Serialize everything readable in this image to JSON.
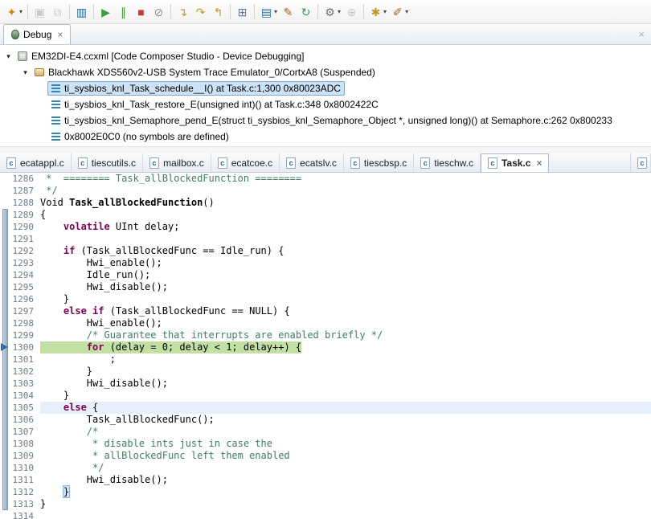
{
  "toolbar": {
    "items": [
      {
        "name": "new",
        "glyph": "✦",
        "color": "#c08a00",
        "dropdown": true
      },
      {
        "sep": true
      },
      {
        "name": "save",
        "glyph": "▣",
        "color": "#8a8a8a",
        "disabled": true
      },
      {
        "name": "save-all",
        "glyph": "⧉",
        "color": "#8a8a8a",
        "disabled": true
      },
      {
        "sep": true
      },
      {
        "name": "console",
        "glyph": "▥",
        "color": "#2f6bad"
      },
      {
        "sep": true
      },
      {
        "name": "resume",
        "glyph": "▶",
        "color": "#3c9e3c"
      },
      {
        "name": "suspend",
        "glyph": "∥",
        "color": "#3c9e3c"
      },
      {
        "name": "terminate",
        "glyph": "■",
        "color": "#c23b3b"
      },
      {
        "name": "disconnect",
        "glyph": "⊘",
        "color": "#909090"
      },
      {
        "sep": true
      },
      {
        "name": "step-into",
        "glyph": "↴",
        "color": "#c39b1a"
      },
      {
        "name": "step-over",
        "glyph": "↷",
        "color": "#c39b1a"
      },
      {
        "name": "step-return",
        "glyph": "↰",
        "color": "#c39b1a"
      },
      {
        "sep": true
      },
      {
        "name": "registers",
        "glyph": "⊞",
        "color": "#5577aa"
      },
      {
        "sep": true
      },
      {
        "name": "screen",
        "glyph": "▤",
        "color": "#2f6bad",
        "dropdown": true
      },
      {
        "name": "trace",
        "glyph": "✎",
        "color": "#a0622d"
      },
      {
        "name": "refresh",
        "glyph": "↻",
        "color": "#2e9e5b"
      },
      {
        "sep": true
      },
      {
        "name": "build",
        "glyph": "⚙",
        "color": "#707070",
        "dropdown": true
      },
      {
        "name": "search",
        "glyph": "⊕",
        "color": "#888888",
        "disabled": true
      },
      {
        "sep": true
      },
      {
        "name": "target-config",
        "glyph": "✱",
        "color": "#c39b1a",
        "dropdown": true
      },
      {
        "name": "pin",
        "glyph": "✐",
        "color": "#a0622d",
        "dropdown": true
      }
    ]
  },
  "debug_view": {
    "tab": {
      "label": "Debug",
      "close": "×"
    },
    "menu_icon": "×",
    "tree": [
      {
        "level": 0,
        "expanded": true,
        "icon": "target-config",
        "label": "EM32DI-E4.ccxml [Code Composer Studio - Device Debugging]"
      },
      {
        "level": 1,
        "expanded": true,
        "icon": "debug-probe",
        "label": "Blackhawk XDS560v2-USB System Trace Emulator_0/CortxA8 (Suspended)"
      },
      {
        "level": 2,
        "icon": "stack-frame",
        "selected": true,
        "label": "ti_sysbios_knl_Task_schedule__I() at Task.c:1,300 0x80023ADC"
      },
      {
        "level": 2,
        "icon": "stack-frame",
        "label": "ti_sysbios_knl_Task_restore_E(unsigned int)() at Task.c:348 0x8002422C"
      },
      {
        "level": 2,
        "icon": "stack-frame",
        "label": "ti_sysbios_knl_Semaphore_pend_E(struct ti_sysbios_knl_Semaphore_Object *, unsigned long)() at Semaphore.c:262 0x800233"
      },
      {
        "level": 2,
        "icon": "stack-frame",
        "label": "0x8002E0C0 (no symbols are defined)"
      }
    ]
  },
  "editor": {
    "file_icon_letter": "c",
    "tabs": [
      {
        "label": "ecatappl.c"
      },
      {
        "label": "tiescutils.c"
      },
      {
        "label": "mailbox.c"
      },
      {
        "label": "ecatcoe.c"
      },
      {
        "label": "ecatslv.c"
      },
      {
        "label": "tiescbsp.c"
      },
      {
        "label": "tieschw.c"
      },
      {
        "label": "Task.c",
        "active": true
      },
      {
        "label": "",
        "partial": true
      }
    ],
    "range_bar": {
      "from": 1289,
      "to": 1313
    },
    "pointer_line": 1300,
    "lines": [
      {
        "n": 1286,
        "seg": [
          [
            "c",
            " *  ======== Task_allBlockedFunction ========"
          ]
        ]
      },
      {
        "n": 1287,
        "seg": [
          [
            "c",
            " */"
          ]
        ]
      },
      {
        "n": 1288,
        "seg": [
          [
            "p",
            "Void "
          ],
          [
            "f",
            "Task_allBlockedFunction"
          ],
          [
            "p",
            "()"
          ]
        ]
      },
      {
        "n": 1289,
        "seg": [
          [
            "p",
            "{"
          ]
        ]
      },
      {
        "n": 1290,
        "seg": [
          [
            "p",
            "    "
          ],
          [
            "k",
            "volatile"
          ],
          [
            "p",
            " UInt delay;"
          ]
        ]
      },
      {
        "n": 1291,
        "seg": []
      },
      {
        "n": 1292,
        "seg": [
          [
            "p",
            "    "
          ],
          [
            "k",
            "if"
          ],
          [
            "p",
            " (Task_allBlockedFunc == Idle_run) {"
          ]
        ]
      },
      {
        "n": 1293,
        "seg": [
          [
            "p",
            "        Hwi_enable();"
          ]
        ]
      },
      {
        "n": 1294,
        "seg": [
          [
            "p",
            "        Idle_run();"
          ]
        ]
      },
      {
        "n": 1295,
        "seg": [
          [
            "p",
            "        Hwi_disable();"
          ]
        ]
      },
      {
        "n": 1296,
        "seg": [
          [
            "p",
            "    }"
          ]
        ]
      },
      {
        "n": 1297,
        "seg": [
          [
            "p",
            "    "
          ],
          [
            "k",
            "else"
          ],
          [
            "p",
            " "
          ],
          [
            "k",
            "if"
          ],
          [
            "p",
            " (Task_allBlockedFunc == NULL) {"
          ]
        ]
      },
      {
        "n": 1298,
        "seg": [
          [
            "p",
            "        Hwi_enable();"
          ]
        ]
      },
      {
        "n": 1299,
        "seg": [
          [
            "p",
            "        "
          ],
          [
            "c",
            "/* Guarantee that interrupts are enabled briefly */"
          ]
        ]
      },
      {
        "n": 1300,
        "hl": "debug",
        "seg": [
          [
            "p",
            "        "
          ],
          [
            "k",
            "for"
          ],
          [
            "p",
            " (delay = 0; delay < 1; delay++) {"
          ]
        ]
      },
      {
        "n": 1301,
        "seg": [
          [
            "p",
            "            ;"
          ]
        ]
      },
      {
        "n": 1302,
        "seg": [
          [
            "p",
            "        }"
          ]
        ]
      },
      {
        "n": 1303,
        "seg": [
          [
            "p",
            "        Hwi_disable();"
          ]
        ]
      },
      {
        "n": 1304,
        "seg": [
          [
            "p",
            "    }"
          ]
        ]
      },
      {
        "n": 1305,
        "hl": "current",
        "seg": [
          [
            "p",
            "    "
          ],
          [
            "k",
            "else"
          ],
          [
            "p",
            " {"
          ]
        ]
      },
      {
        "n": 1306,
        "seg": [
          [
            "p",
            "        Task_allBlockedFunc();"
          ]
        ]
      },
      {
        "n": 1307,
        "seg": [
          [
            "c",
            "        /*"
          ]
        ]
      },
      {
        "n": 1308,
        "seg": [
          [
            "c",
            "         * disable ints just in case the"
          ]
        ]
      },
      {
        "n": 1309,
        "seg": [
          [
            "c",
            "         * allBlockedFunc left them enabled"
          ]
        ]
      },
      {
        "n": 1310,
        "seg": [
          [
            "c",
            "         */"
          ]
        ]
      },
      {
        "n": 1311,
        "seg": [
          [
            "p",
            "        Hwi_disable();"
          ]
        ]
      },
      {
        "n": 1312,
        "seg": [
          [
            "p",
            "    "
          ],
          [
            "m",
            "}"
          ]
        ]
      },
      {
        "n": 1313,
        "seg": [
          [
            "p",
            "}"
          ]
        ]
      },
      {
        "n": 1314,
        "seg": []
      }
    ]
  }
}
